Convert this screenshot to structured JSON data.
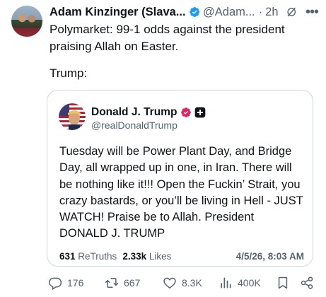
{
  "author": {
    "name": "Adam Kinzinger (Slava...",
    "handle": "@Adam...",
    "separator": "·",
    "time": "2h"
  },
  "tweet": {
    "line1": "Polymarket:  99-1 odds against the president praising Allah on Easter.",
    "line2": "Trump:"
  },
  "quote": {
    "name": "Donald J. Trump",
    "handle": "@realDonaldTrump",
    "body": "Tuesday will be Power Plant Day, and Bridge Day, all wrapped up in one, in Iran. There will be nothing like it!!! Open the Fuckin’ Strait, you crazy bastards, or you’ll be living in Hell - JUST WATCH! Praise be to Allah. President DONALD J. TRUMP",
    "retruths_count": "631",
    "retruths_label": "ReTruths",
    "likes_count": "2.33k",
    "likes_label": "Likes",
    "date": "4/5/26, 8:03 AM"
  },
  "actions": {
    "replies": "176",
    "reposts": "667",
    "likes": "8.3K",
    "views": "400K"
  },
  "colors": {
    "verified": "#1d9bf0",
    "truth_badge": "#e0245e",
    "muted": "#536471",
    "border": "#cfd9de"
  }
}
